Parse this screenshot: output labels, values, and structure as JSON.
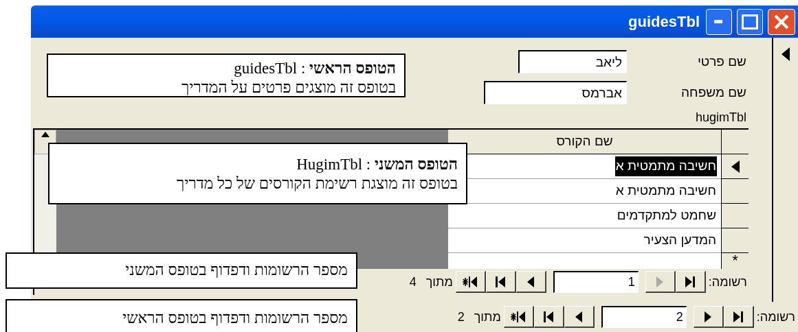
{
  "window": {
    "title": "guidesTbl"
  },
  "main_form": {
    "fields": [
      {
        "label": "שם פרטי",
        "value": "ליאב"
      },
      {
        "label": "שם משפחה",
        "value": "אברמס"
      }
    ],
    "subform_label": "hugimTbl",
    "subform": {
      "column": "שם הקורס",
      "rows": [
        {
          "text": "חשיבה מתמטית א",
          "selected": true
        },
        {
          "text": "חשיבה מתמטית א",
          "selected": false
        },
        {
          "text": "שחמט למתקדמים",
          "selected": false
        },
        {
          "text": "המדען הצעיר",
          "selected": false
        }
      ],
      "new_row_marker": "*",
      "navigation": {
        "label": "רשומה:",
        "current": "1",
        "of_label": "מתוך",
        "total": "4",
        "previous_disabled": true
      }
    },
    "navigation": {
      "label": "רשומה:",
      "current": "2",
      "of_label": "מתוך",
      "total": "2",
      "previous_disabled": false
    }
  },
  "callouts": [
    {
      "lines": [
        "**הטופס הראשי** : guidesTbl",
        "בטופס זה מוצגים פרטים על המדריך"
      ]
    },
    {
      "lines": [
        "**הטופס המשני** : HugimTbl",
        "בטופס זה מוצגת רשימת הקורסים של כל מדריך"
      ]
    },
    {
      "lines": [
        "מספר הרשומות ודפדוף בטופס המשני"
      ]
    },
    {
      "lines": [
        "מספר הרשומות ודפדוף בטופס הראשי"
      ]
    }
  ]
}
